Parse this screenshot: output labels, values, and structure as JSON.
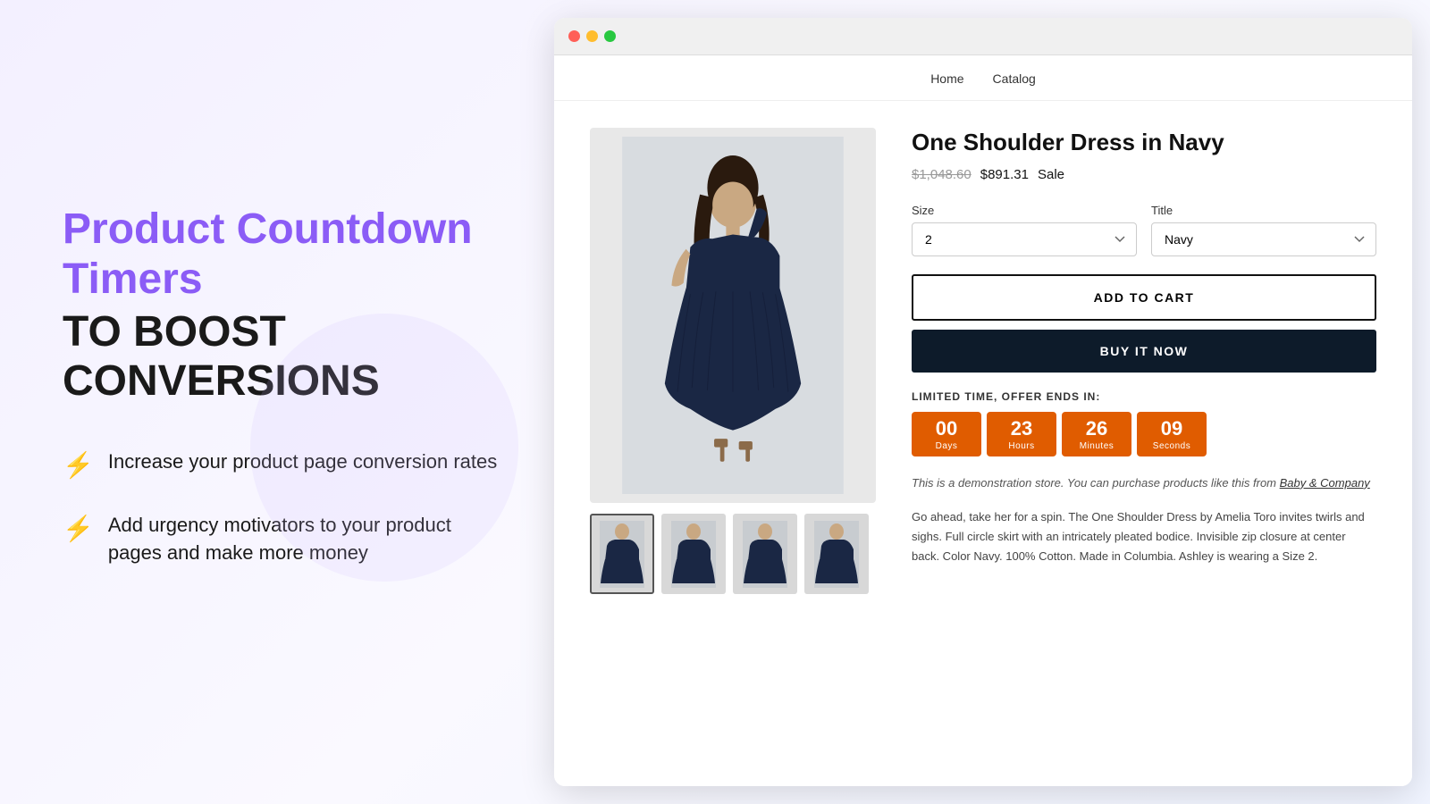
{
  "left": {
    "title_purple": "Product Countdown Timers",
    "title_black": "TO BOOST CONVERSIONS",
    "features": [
      {
        "icon": "⚡",
        "text": "Increase your product page conversion rates"
      },
      {
        "icon": "⚡",
        "text": "Add urgency motivators to your product pages and make more money"
      }
    ]
  },
  "browser": {
    "nav": {
      "items": [
        "Home",
        "Catalog"
      ]
    },
    "product": {
      "name": "One Shoulder Dress in Navy",
      "price_original": "$1,048.60",
      "price_sale": "$891.31",
      "price_sale_label": "Sale",
      "size_label": "Size",
      "size_value": "2",
      "title_label": "Title",
      "title_value": "Navy",
      "btn_add_to_cart": "ADD TO CART",
      "btn_buy_now": "BUY IT NOW",
      "countdown": {
        "label": "LIMITED TIME, OFFER ENDS IN:",
        "days": "00",
        "days_label": "Days",
        "hours": "23",
        "hours_label": "Hours",
        "minutes": "26",
        "minutes_label": "Minutes",
        "seconds": "09",
        "seconds_label": "Seconds"
      },
      "demo_note": "This is a demonstration store. You can purchase products like this from Baby & Company",
      "demo_link": "Baby & Company",
      "description": "Go ahead, take her for a spin. The One Shoulder Dress by Amelia Toro invites twirls and sighs. Full circle skirt with an intricately pleated bodice. Invisible zip closure at center back. Color Navy. 100% Cotton. Made in Columbia. Ashley is wearing a Size 2."
    }
  },
  "colors": {
    "purple": "#8B5CF6",
    "orange": "#e05c00",
    "dark_navy": "#0d1b2a"
  }
}
